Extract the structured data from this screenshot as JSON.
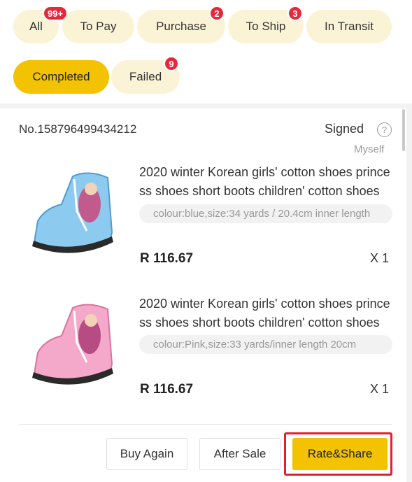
{
  "tabs": [
    {
      "label": "All",
      "badge": "99+"
    },
    {
      "label": "To Pay",
      "badge": ""
    },
    {
      "label": "Purchase",
      "badge": "2"
    },
    {
      "label": "To Ship",
      "badge": "3"
    },
    {
      "label": "In Transit",
      "badge": ""
    },
    {
      "label": "Completed",
      "badge": "",
      "active": true
    },
    {
      "label": "Failed",
      "badge": "9"
    }
  ],
  "order": {
    "number": "No.158796499434212",
    "status": "Signed",
    "help_glyph": "?",
    "receiver": "Myself",
    "items": [
      {
        "title": "2020 winter Korean girls' cotton shoes princess shoes short boots children' cotton shoes",
        "spec": "colour:blue,size:34 yards / 20.4cm inner length",
        "price": "R 116.67",
        "qty": "X 1",
        "image_icon": "blue-princess-boot",
        "image_color": "#7fc3e8"
      },
      {
        "title": "2020 winter Korean girls' cotton shoes princess shoes short boots children' cotton shoes",
        "spec": "colour:Pink,size:33 yards/inner length 20cm",
        "price": "R 116.67",
        "qty": "X 1",
        "image_icon": "pink-princess-boot",
        "image_color": "#f4a6c8"
      }
    ]
  },
  "actions": {
    "buy_again": "Buy Again",
    "after_sale": "After Sale",
    "rate_share": "Rate&Share"
  },
  "colors": {
    "accent": "#f3c200",
    "tab_bg": "#fbf3d6",
    "badge": "#e8283a",
    "highlight": "#e5202e"
  }
}
